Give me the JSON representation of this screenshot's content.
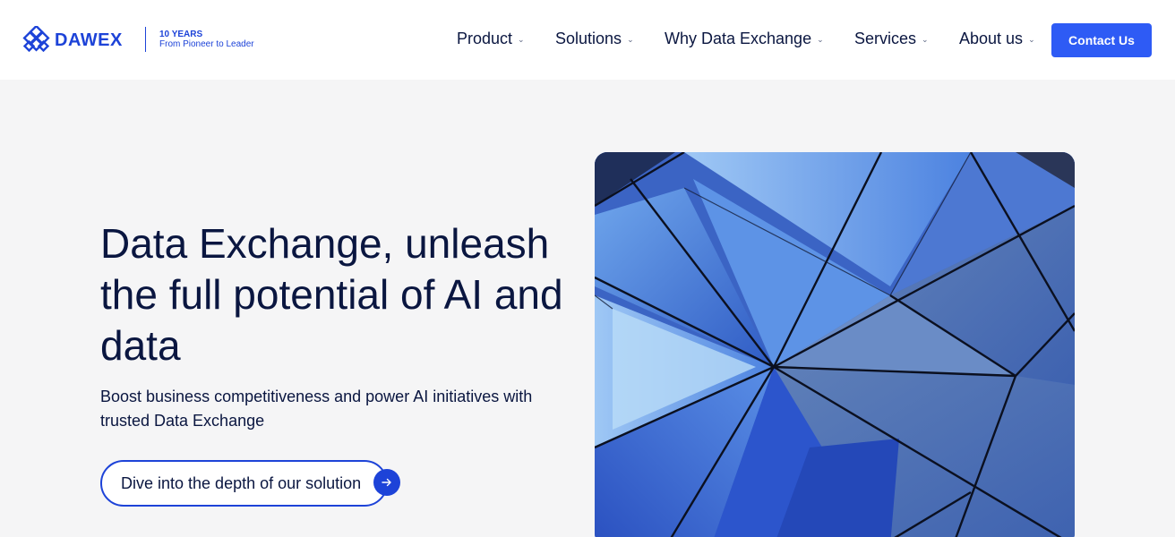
{
  "brand": {
    "name": "DAWEX",
    "tagline_line1": "10 YEARS",
    "tagline_line2": "From Pioneer to Leader",
    "color": "#1d43d8"
  },
  "nav": {
    "items": [
      {
        "label": "Product",
        "icon": "chevron-down-icon"
      },
      {
        "label": "Solutions",
        "icon": "chevron-down-icon"
      },
      {
        "label": "Why Data Exchange",
        "icon": "chevron-down-icon"
      },
      {
        "label": "Services",
        "icon": "chevron-down-icon"
      },
      {
        "label": "About us",
        "icon": "chevron-down-icon"
      }
    ],
    "contact_label": "Contact Us"
  },
  "hero": {
    "title": "Data Exchange, unleash the full potential of AI and data",
    "subtitle": "Boost business competitiveness and power AI initiatives with trusted Data Exchange",
    "cta_label": "Dive into the depth of our solution",
    "cta_icon": "arrow-right-icon"
  },
  "colors": {
    "primary": "#2e5bf5",
    "text": "#0a1640",
    "background": "#f5f5f6"
  }
}
